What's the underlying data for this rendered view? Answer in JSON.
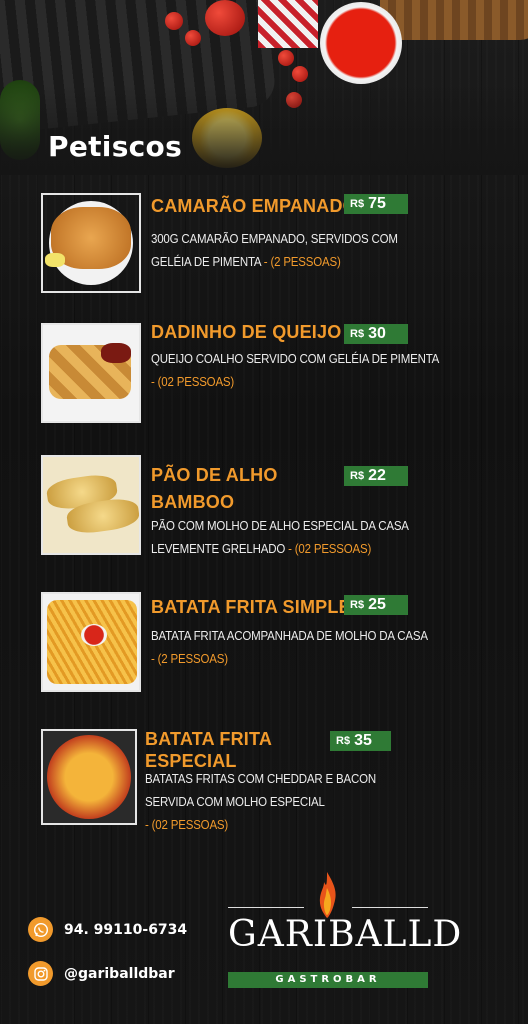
{
  "section_title": "Petiscos",
  "items": [
    {
      "name_lines": [
        "CAMARÃO EMPANADO",
        ""
      ],
      "currency": "R$",
      "price": "75",
      "desc_lines": [
        "300G CAMARÃO EMPANADO, SERVIDOS COM",
        "GELÉIA DE PIMENTA"
      ],
      "serves": " - (2 PESSOAS)",
      "photo_icon": "fried-shrimp-photo"
    },
    {
      "name_lines": [
        "DADINHO DE QUEIJO",
        ""
      ],
      "currency": "R$",
      "price": "30",
      "desc_lines": [
        "QUEIJO COALHO SERVIDO COM GELÉIA DE PIMENTA",
        ""
      ],
      "serves": " - (02 PESSOAS)",
      "photo_icon": "cheese-cubes-photo"
    },
    {
      "name_lines": [
        "PÃO DE ALHO",
        "BAMBOO"
      ],
      "currency": "R$",
      "price": "22",
      "desc_lines": [
        "PÃO COM MOLHO DE ALHO ESPECIAL DA CASA",
        "LEVEMENTE GRELHADO"
      ],
      "serves": " - (02 PESSOAS)",
      "photo_icon": "garlic-bread-photo"
    },
    {
      "name_lines": [
        "BATATA FRITA SIMPLES",
        ""
      ],
      "currency": "R$",
      "price": "25",
      "desc_lines": [
        "BATATA FRITA ACOMPANHADA DE MOLHO DA CASA",
        ""
      ],
      "serves": " - (2 PESSOAS)",
      "photo_icon": "french-fries-photo"
    },
    {
      "name_lines": [
        "BATATA FRITA",
        "ESPECIAL"
      ],
      "currency": "R$",
      "price": "35",
      "desc_lines": [
        "BATATAS FRITAS COM CHEDDAR E BACON",
        "SERVIDA COM MOLHO ESPECIAL"
      ],
      "serves": " - (02 PESSOAS)",
      "photo_icon": "loaded-fries-photo"
    }
  ],
  "contacts": {
    "phone": "94. 99110-6734",
    "phone_icon": "whatsapp-icon",
    "instagram": "@gariballdbar",
    "instagram_icon": "instagram-icon"
  },
  "brand": {
    "name": "GARIBALLD",
    "tagline": "GASTROBAR",
    "logo_icon": "flame-icon"
  },
  "colors": {
    "accent": "#f19a2c",
    "price_bg": "#2f7a35",
    "background": "#141414"
  }
}
